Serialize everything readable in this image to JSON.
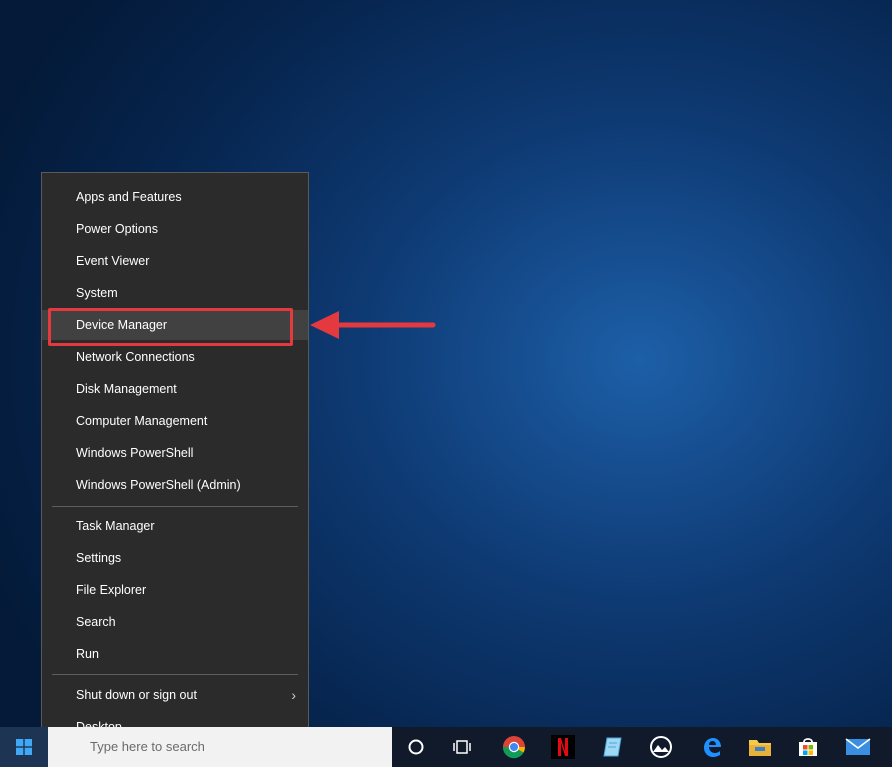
{
  "menu": {
    "items_group1": [
      "Apps and Features",
      "Power Options",
      "Event Viewer",
      "System",
      "Device Manager",
      "Network Connections",
      "Disk Management",
      "Computer Management",
      "Windows PowerShell",
      "Windows PowerShell (Admin)"
    ],
    "items_group2": [
      "Task Manager",
      "Settings",
      "File Explorer",
      "Search",
      "Run"
    ],
    "items_group3": [
      "Shut down or sign out",
      "Desktop"
    ],
    "highlighted_item": "Device Manager"
  },
  "taskbar": {
    "search_placeholder": "Type here to search",
    "icons": [
      "start-icon",
      "cortana-icon",
      "task-view-icon",
      "chrome-icon",
      "netflix-icon",
      "notepad-icon",
      "photos-icon",
      "edge-icon",
      "file-explorer-icon",
      "store-icon",
      "mail-icon"
    ]
  },
  "colors": {
    "menu_bg": "#2b2b2b",
    "highlight_red": "#e53940"
  }
}
